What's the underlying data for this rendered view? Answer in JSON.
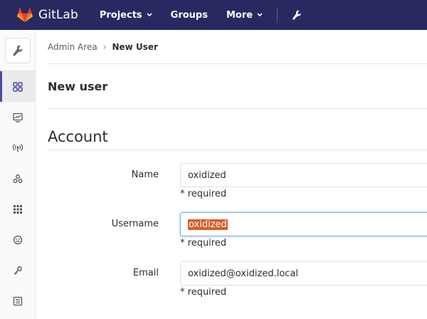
{
  "brand": {
    "name": "GitLab"
  },
  "nav": {
    "projects": "Projects",
    "groups": "Groups",
    "more": "More"
  },
  "breadcrumb": {
    "parent": "Admin Area",
    "sep": "›",
    "current": "New User"
  },
  "page": {
    "title": "New user",
    "section": "Account"
  },
  "form": {
    "name": {
      "label": "Name",
      "value": "oxidized",
      "hint": "* required"
    },
    "username": {
      "label": "Username",
      "value": "oxidized",
      "hint": "* required"
    },
    "email": {
      "label": "Email",
      "value": "oxidized@oxidized.local",
      "hint": "* required"
    }
  },
  "colors": {
    "topbar": "#292961",
    "active_indicator": "#4b4ba3",
    "selection": "#d95c2b"
  },
  "sidebar": {
    "icons": [
      "wrench-icon",
      "overview-icon",
      "monitoring-icon",
      "messages-icon",
      "hooks-icon",
      "applications-icon",
      "abuse-reports-icon",
      "deploy-keys-icon",
      "service-templates-icon"
    ]
  }
}
